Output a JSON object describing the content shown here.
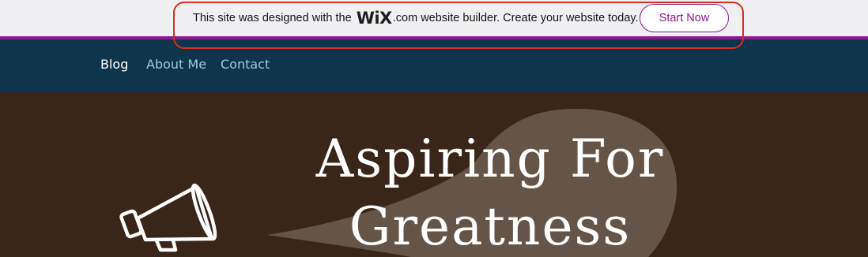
{
  "wix_banner": {
    "prefix": "This site was designed with the",
    "logo": "WiX",
    "suffix": ".com website builder. Create your website today.",
    "button_label": "Start Now"
  },
  "nav": {
    "items": [
      {
        "label": "Blog"
      },
      {
        "label": "About Me"
      },
      {
        "label": "Contact"
      }
    ]
  },
  "hero": {
    "title_line1": "Aspiring For",
    "title_line2": "Greatness"
  },
  "colors": {
    "banner_accent": "#8e1a8f",
    "highlight_outline": "#d62f1f",
    "nav_background": "#0e354b",
    "hero_background": "#3a251b",
    "speech_bubble": "#655548"
  },
  "icons": [
    "megaphone-icon",
    "speech-bubble-shape"
  ]
}
